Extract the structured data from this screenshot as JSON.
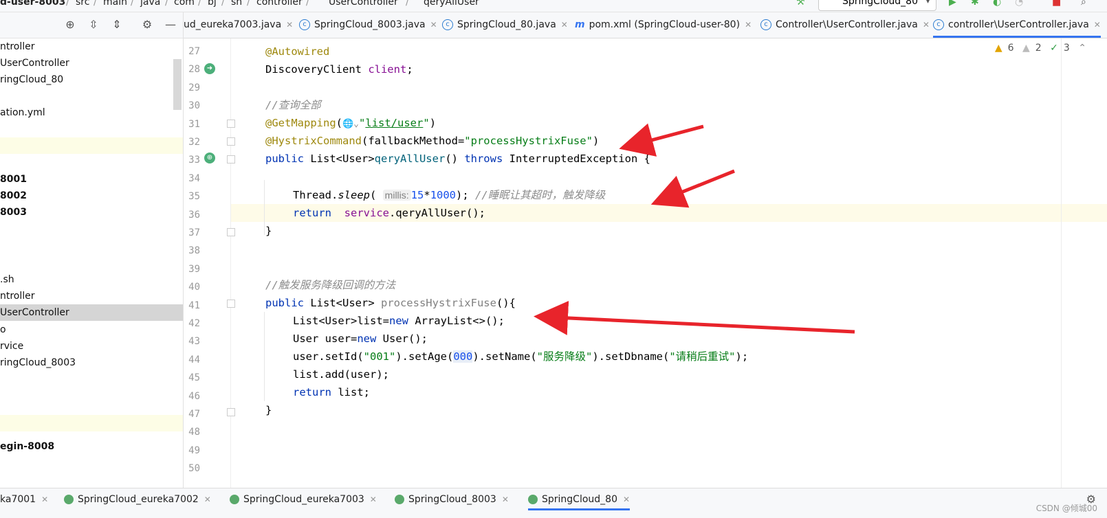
{
  "breadcrumb": {
    "items": [
      "d-user-8003",
      "src",
      "main",
      "java",
      "com",
      "bj",
      "sh",
      "controller",
      "UserController",
      "qeryAllUser"
    ],
    "run_config": "SpringCloud_80"
  },
  "tabs": [
    {
      "label": "ud_eureka7003.java",
      "icon": "java-class-icon"
    },
    {
      "label": "SpringCloud_8003.java",
      "icon": "spring-boot-class-icon"
    },
    {
      "label": "SpringCloud_80.java",
      "icon": "spring-boot-class-icon"
    },
    {
      "label": "pom.xml (SpringCloud-user-80)",
      "icon": "maven-icon"
    },
    {
      "label": "Controller\\UserController.java",
      "icon": "java-class-icon"
    },
    {
      "label": "controller\\UserController.java",
      "icon": "java-class-icon",
      "active": true
    }
  ],
  "tree": {
    "items": [
      {
        "label": "ntroller"
      },
      {
        "label": " UserController"
      },
      {
        "label": "ringCloud_80"
      },
      {
        "label": ""
      },
      {
        "label": "ation.yml"
      },
      {
        "label": ""
      },
      {
        "label": ""
      },
      {
        "label": "8001",
        "bold": true
      },
      {
        "label": "8002",
        "bold": true
      },
      {
        "label": "8003",
        "bold": true
      },
      {
        "label": ""
      },
      {
        "label": ""
      },
      {
        "label": ""
      },
      {
        "label": ".sh"
      },
      {
        "label": "ntroller"
      },
      {
        "label": " UserController",
        "selected": true
      },
      {
        "label": "o"
      },
      {
        "label": "rvice"
      },
      {
        "label": "ringCloud_8003"
      },
      {
        "label": ""
      },
      {
        "label": ""
      },
      {
        "label": ""
      },
      {
        "label": "egin-8008",
        "bold": true
      }
    ]
  },
  "inspections": {
    "warnings": "6",
    "weak_warnings": "2",
    "ok": "3"
  },
  "line_numbers": [
    "27",
    "28",
    "29",
    "30",
    "31",
    "32",
    "33",
    "34",
    "35",
    "36",
    "37",
    "38",
    "39",
    "40",
    "41",
    "42",
    "43",
    "44",
    "45",
    "46",
    "47",
    "48",
    "49",
    "50"
  ],
  "code": {
    "l27": "@Autowired",
    "l28_type": "DiscoveryClient ",
    "l28_field": "client",
    "l28_end": ";",
    "l30": "//查询全部",
    "l31_ann": "@GetMapping",
    "l31_open": "(",
    "l31_q1": "\"",
    "l31_path": "list/user",
    "l31_q2": "\"",
    "l31_close": ")",
    "l32_ann": "@HystrixCommand",
    "l32_open": "(fallbackMethod=",
    "l32_str": "\"processHystrixFuse\"",
    "l32_close": ")",
    "l33_kw": "public",
    "l33_type": " List<User>",
    "l33_name": "qeryAllUser",
    "l33_mid": "() ",
    "l33_throws": "throws",
    "l33_end": " InterruptedException {",
    "l35_pre": "Thread.",
    "l35_sleep": "sleep",
    "l35_open": "( ",
    "l35_hint": "millis:",
    "l35_n1": "15",
    "l35_op": "*",
    "l35_n2": "1000",
    "l35_close": "); ",
    "l35_cmt": "//睡眠让其超时，触发降级",
    "l36_kw": "return",
    "l36_sp": "  ",
    "l36_field": "service",
    "l36_call": ".qeryAllUser();",
    "l37": "}",
    "l40": "//触发服务降级回调的方法",
    "l41_kw": "public",
    "l41_type": " List<User> ",
    "l41_name": "processHystrixFuse",
    "l41_end": "(){",
    "l42_a": "List<User>list=",
    "l42_new": "new",
    "l42_b": " ArrayList<>();",
    "l43_a": "User user=",
    "l43_new": "new",
    "l43_b": " User();",
    "l44_a": "user.setId(",
    "l44_s1": "\"001\"",
    "l44_b": ").setAge(",
    "l44_n": "000",
    "l44_c": ").setName(",
    "l44_s2": "\"服务降级\"",
    "l44_d": ").setDbname(",
    "l44_s3": "\"请稍后重试\"",
    "l44_e": ");",
    "l45": "list.add(user);",
    "l46_kw": "return",
    "l46_b": " list;",
    "l47": "}"
  },
  "run_tabs": [
    {
      "label": "ka7001"
    },
    {
      "label": "SpringCloud_eureka7002"
    },
    {
      "label": "SpringCloud_eureka7003"
    },
    {
      "label": "SpringCloud_8003"
    },
    {
      "label": "SpringCloud_80",
      "active": true
    }
  ],
  "watermark": "CSDN @倾城00",
  "colors": {
    "arrow": "#e8242b",
    "accent": "#3574f0"
  }
}
